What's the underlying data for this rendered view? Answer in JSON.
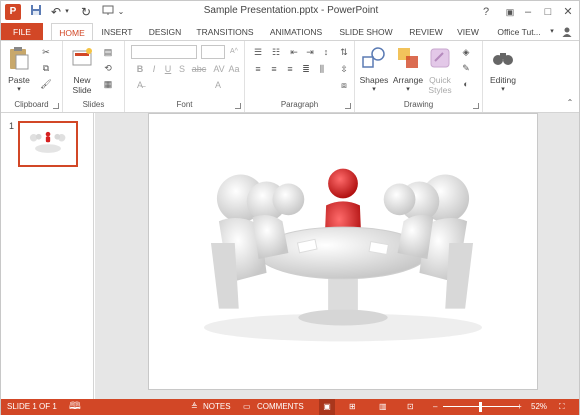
{
  "app": {
    "icon_text": "P",
    "title": "Sample Presentation.pptx - PowerPoint",
    "brand_color": "#d24726"
  },
  "window_controls": {
    "help": "?",
    "minimize": "–",
    "restore": "□",
    "close": "✕"
  },
  "tabs": [
    {
      "label": "FILE"
    },
    {
      "label": "HOME"
    },
    {
      "label": "INSERT"
    },
    {
      "label": "DESIGN"
    },
    {
      "label": "TRANSITIONS"
    },
    {
      "label": "ANIMATIONS"
    },
    {
      "label": "SLIDE SHOW"
    },
    {
      "label": "REVIEW"
    },
    {
      "label": "VIEW"
    },
    {
      "label": "Office Tut..."
    }
  ],
  "ribbon": {
    "clipboard": {
      "paste": "Paste",
      "group": "Clipboard"
    },
    "slides": {
      "new_slide_1": "New",
      "new_slide_2": "Slide",
      "group": "Slides"
    },
    "font": {
      "bold": "B",
      "italic": "I",
      "underline": "U",
      "strike": "S",
      "abc": "abc",
      "av": "AV",
      "aa": "Aa",
      "group": "Font"
    },
    "paragraph": {
      "group": "Paragraph"
    },
    "drawing": {
      "shapes": "Shapes",
      "arrange": "Arrange",
      "quick_1": "Quick",
      "quick_2": "Styles",
      "group": "Drawing"
    },
    "editing": {
      "label": "Editing"
    }
  },
  "slides_pane": {
    "slide_number": "1"
  },
  "status": {
    "slide_info": "SLIDE 1 OF 1",
    "notes": "NOTES",
    "comments": "COMMENTS",
    "zoom": "52%"
  }
}
